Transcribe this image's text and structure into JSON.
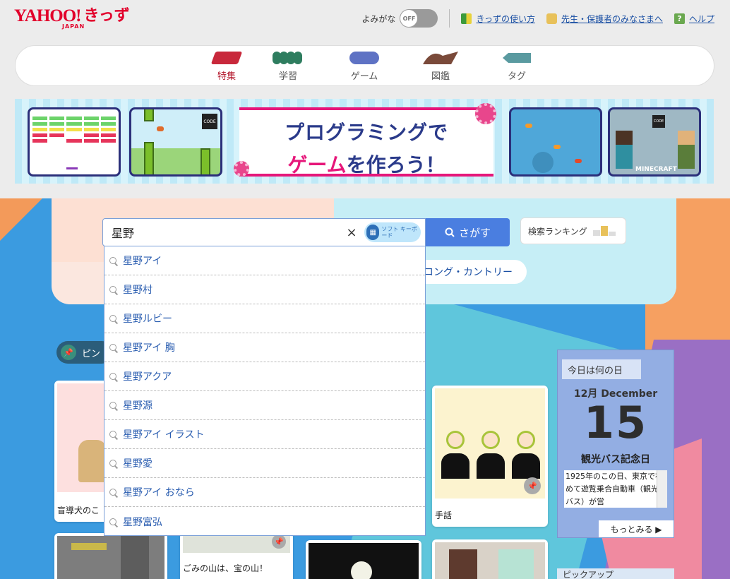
{
  "header": {
    "logo_yahoo": "YAHOO!",
    "logo_japan": "JAPAN",
    "logo_kids": "きっず",
    "yomigana_label": "よみがな",
    "toggle_state": "OFF",
    "links": [
      {
        "label": "きっずの使い方",
        "icon": "leaf-icon"
      },
      {
        "label": "先生・保護者のみなさまへ",
        "icon": "person-icon"
      },
      {
        "label": "ヘルプ",
        "icon": "help-icon"
      }
    ],
    "help_glyph": "?"
  },
  "nav": {
    "items": [
      {
        "label": "特集",
        "active": true,
        "color": "#c8283b"
      },
      {
        "label": "学習",
        "active": false,
        "color": "#2e7d5f"
      },
      {
        "label": "ゲーム",
        "active": false,
        "color": "#5e72c4"
      },
      {
        "label": "図鑑",
        "active": false,
        "color": "#7a4a3a"
      },
      {
        "label": "タグ",
        "active": false,
        "color": "#5a9aa0"
      }
    ]
  },
  "banner": {
    "title_line1": "プログラミングで",
    "title_line2_pink": "ゲーム",
    "title_line2_rest": "を作ろう！",
    "code_label": "CODE",
    "minecraft_label": "MINECRAFT"
  },
  "search": {
    "value": "星野",
    "clear_glyph": "×",
    "soft_keyboard_label": "ソフト キーボード",
    "button_label": "さがす",
    "ranking_label": "検索ランキング",
    "chip_label": "コング・カントリー"
  },
  "suggestions": [
    "星野アイ",
    "星野村",
    "星野ルビー",
    "星野アイ 胸",
    "星野アクア",
    "星野源",
    "星野アイ イラスト",
    "星野愛",
    "星野アイ おなら",
    "星野富弘"
  ],
  "pins": {
    "label": "ピン",
    "pin_glyph": "📌"
  },
  "cards": {
    "guide_dog_caption": "盲導犬のこ",
    "sign_caption": "手話",
    "garbage_caption": "ごみの山は、宝の山！"
  },
  "today": {
    "tag": "今日は何の日",
    "month": "12月 December",
    "day": "15",
    "event": "観光バス記念日",
    "desc": "1925年のこの日、東京で初めて遊覧乗合自動車（観光バス）が営",
    "more": "もっとみる ▶"
  },
  "pickup": {
    "label": "ピックアップ"
  }
}
